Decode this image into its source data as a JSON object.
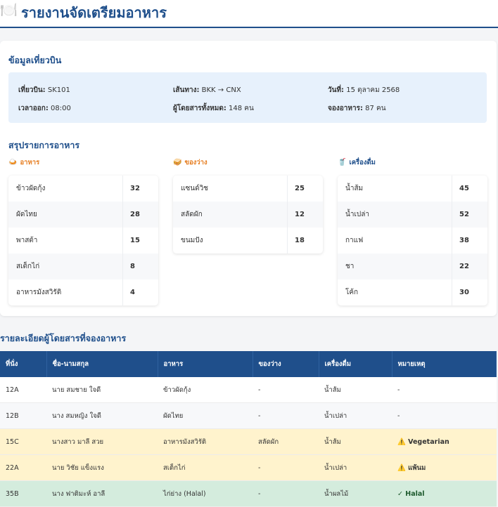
{
  "header": {
    "icon": "🍽️",
    "title": "รายงานจัดเตรียมอาหาร"
  },
  "flight_info": {
    "heading": "ข้อมูลเที่ยวบิน",
    "flight_label": "เที่ยวบิน:",
    "flight_value": "SK101",
    "route_label": "เส้นทาง:",
    "route_value": "BKK → CNX",
    "date_label": "วันที่:",
    "date_value": "15 ตุลาคม 2568",
    "departure_label": "เวลาออก:",
    "departure_value": "08:00",
    "passengers_label": "ผู้โดยสารทั้งหมด:",
    "passengers_value": "148 คน",
    "booked_label": "จองอาหาร:",
    "booked_value": "87 คน"
  },
  "summary": {
    "heading": "สรุปรายการอาหาร",
    "food": {
      "icon": "🍛",
      "label": "อาหาร",
      "color": "#e67e22",
      "items": [
        {
          "name": "ข้าวผัดกุ้ง",
          "count": "32"
        },
        {
          "name": "ผัดไทย",
          "count": "28"
        },
        {
          "name": "พาสต้า",
          "count": "15"
        },
        {
          "name": "สเต็กไก่",
          "count": "8"
        },
        {
          "name": "อาหารมังสวิรัติ",
          "count": "4"
        }
      ]
    },
    "snacks": {
      "icon": "🥪",
      "label": "ของว่าง",
      "color": "#e67e22",
      "items": [
        {
          "name": "แซนด์วิช",
          "count": "25"
        },
        {
          "name": "สลัดผัก",
          "count": "12"
        },
        {
          "name": "ขนมปัง",
          "count": "18"
        }
      ]
    },
    "drinks": {
      "icon": "🥤",
      "label": "เครื่องดื่ม",
      "color": "#1f4f8b",
      "items": [
        {
          "name": "น้ำส้ม",
          "count": "45"
        },
        {
          "name": "น้ำเปล่า",
          "count": "52"
        },
        {
          "name": "กาแฟ",
          "count": "38"
        },
        {
          "name": "ชา",
          "count": "22"
        },
        {
          "name": "โค้ก",
          "count": "30"
        }
      ]
    }
  },
  "passengers": {
    "heading": "รายละเอียดผู้โดยสารที่จองอาหาร",
    "columns": [
      "ที่นั่ง",
      "ชื่อ-นามสกุล",
      "อาหาร",
      "ของว่าง",
      "เครื่องดื่ม",
      "หมายเหตุ"
    ],
    "rows": [
      {
        "seat": "12A",
        "name": "นาย สมชาย ใจดี",
        "food": "ข้าวผัดกุ้ง",
        "snack": "-",
        "drink": "น้ำส้ม",
        "note": "-",
        "note_icon": "",
        "style": "white"
      },
      {
        "seat": "12B",
        "name": "นาง สมหญิง ใจดี",
        "food": "ผัดไทย",
        "snack": "-",
        "drink": "น้ำเปล่า",
        "note": "-",
        "note_icon": "",
        "style": "grey"
      },
      {
        "seat": "15C",
        "name": "นางสาว มาลี สวย",
        "food": "อาหารมังสวิรัติ",
        "snack": "สลัดผัก",
        "drink": "น้ำส้ม",
        "note": "Vegetarian",
        "note_icon": "⚠️",
        "style": "yellow"
      },
      {
        "seat": "22A",
        "name": "นาย วิชัย แข็งแรง",
        "food": "สเต็กไก่",
        "snack": "-",
        "drink": "น้ำเปล่า",
        "note": "แพ้นม",
        "note_icon": "⚠️",
        "style": "yellow"
      },
      {
        "seat": "35B",
        "name": "นาง ฟาติมะห์ อาลี",
        "food": "ไก่ย่าง (Halal)",
        "snack": "-",
        "drink": "น้ำผลไม้",
        "note": "Halal",
        "note_icon": "✓",
        "style": "green"
      }
    ]
  }
}
